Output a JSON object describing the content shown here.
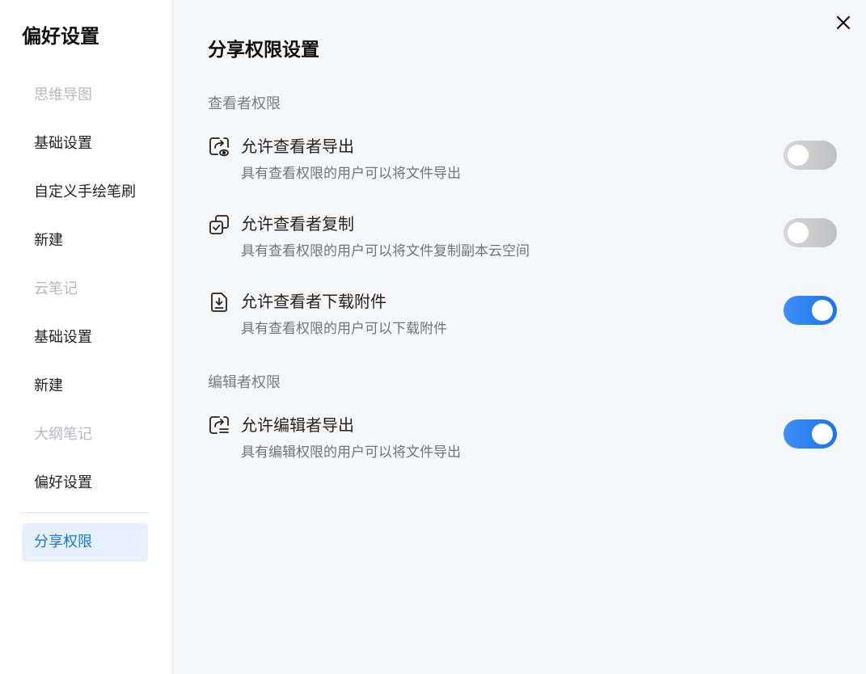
{
  "sidebar": {
    "title": "偏好设置",
    "groups": [
      {
        "label": "思维导图",
        "items": [
          "基础设置",
          "自定义手绘笔刷",
          "新建"
        ]
      },
      {
        "label": "云笔记",
        "items": [
          "基础设置",
          "新建"
        ]
      },
      {
        "label": "大纲笔记",
        "items": [
          "偏好设置"
        ]
      }
    ],
    "active_item": "分享权限"
  },
  "main": {
    "title": "分享权限设置",
    "sections": [
      {
        "label": "查看者权限",
        "settings": [
          {
            "icon": "export-view-icon",
            "name": "允许查看者导出",
            "desc": "具有查看权限的用户可以将文件导出",
            "enabled": false
          },
          {
            "icon": "copy-check-icon",
            "name": "允许查看者复制",
            "desc": "具有查看权限的用户可以将文件复制副本云空间",
            "enabled": false
          },
          {
            "icon": "download-file-icon",
            "name": "允许查看者下载附件",
            "desc": "具有查看权限的用户可以下载附件",
            "enabled": true
          }
        ]
      },
      {
        "label": "编辑者权限",
        "settings": [
          {
            "icon": "export-edit-icon",
            "name": "允许编辑者导出",
            "desc": "具有编辑权限的用户可以将文件导出",
            "enabled": true
          }
        ]
      }
    ]
  },
  "colors": {
    "accent": "#1677e6",
    "toggle_on": "#2a82f2",
    "toggle_off": "#c8c9cb",
    "active_bg": "#e7f1fe"
  },
  "icons": {
    "close": "close-icon"
  }
}
